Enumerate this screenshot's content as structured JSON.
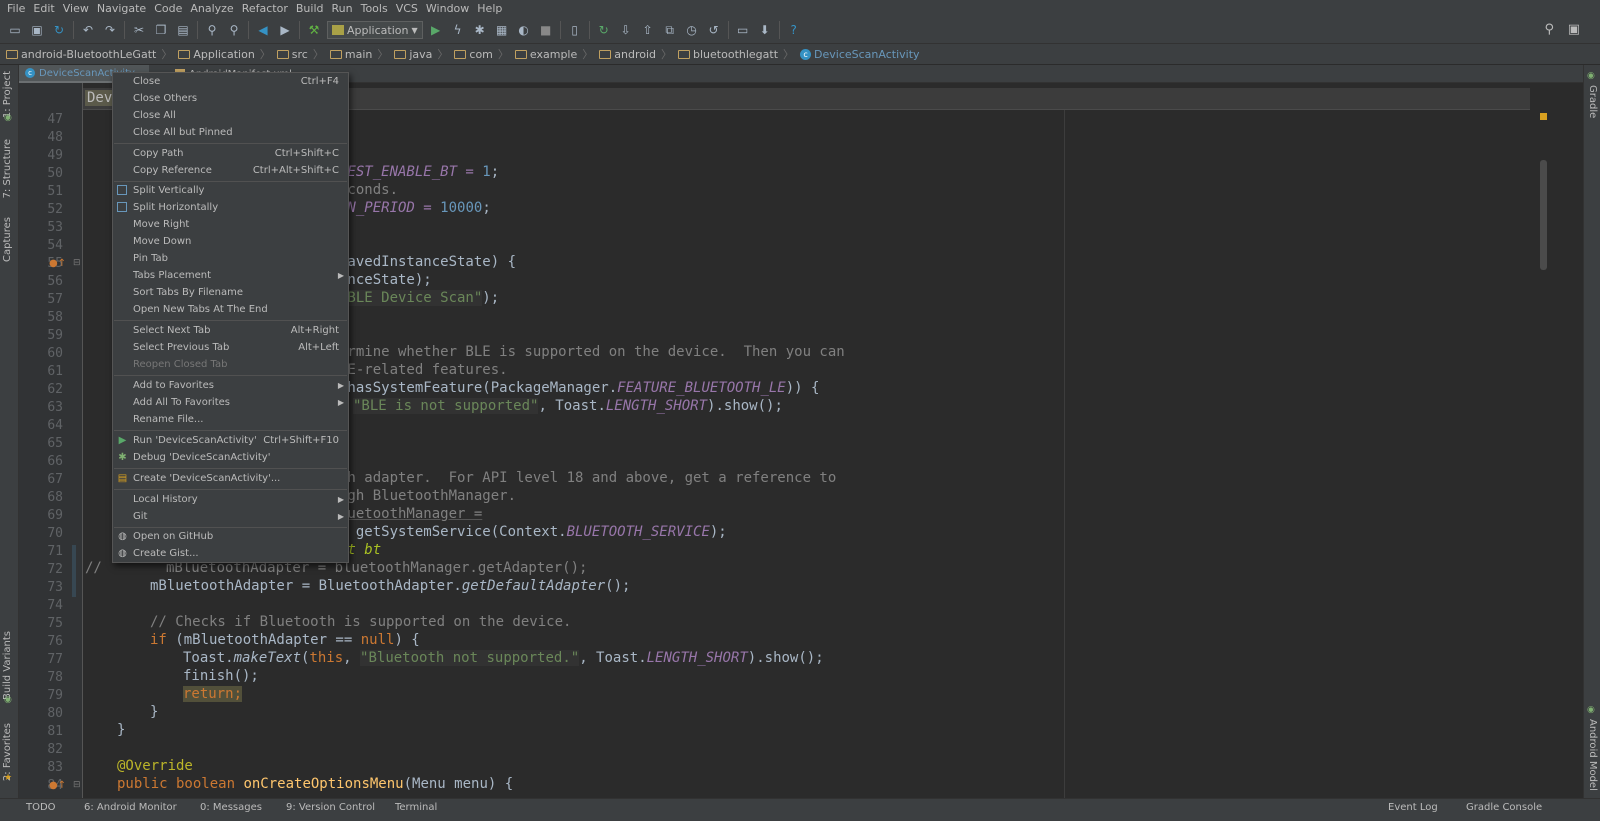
{
  "menubar": [
    "File",
    "Edit",
    "View",
    "Navigate",
    "Code",
    "Analyze",
    "Refactor",
    "Build",
    "Run",
    "Tools",
    "VCS",
    "Window",
    "Help"
  ],
  "toolbar": {
    "run_config": "Application"
  },
  "breadcrumbs": [
    "android-BluetoothLeGatt",
    "Application",
    "src",
    "main",
    "java",
    "com",
    "example",
    "android",
    "bluetoothlegatt",
    "DeviceScanActivity"
  ],
  "tabs": [
    "DeviceScanActivity",
    "AndroidManifest.xml"
  ],
  "scope_label": "Devi",
  "left_tools": [
    "1: Project",
    "7: Structure",
    "Captures",
    "Build Variants",
    "2: Favorites"
  ],
  "right_tools": [
    "Gradle",
    "Android Model"
  ],
  "bottom_tools": [
    "TODO",
    "6: Android Monitor",
    "0: Messages",
    "9: Version Control",
    "Terminal",
    "Event Log",
    "Gradle Console"
  ],
  "context_menu": [
    {
      "label": "Close",
      "shortcut": "Ctrl+F4"
    },
    {
      "label": "Close Others"
    },
    {
      "label": "Close All"
    },
    {
      "label": "Close All but Pinned"
    },
    {
      "sep": true
    },
    {
      "label": "Copy Path",
      "shortcut": "Ctrl+Shift+C"
    },
    {
      "label": "Copy Reference",
      "shortcut": "Ctrl+Alt+Shift+C"
    },
    {
      "sep": true
    },
    {
      "label": "Split Vertically",
      "icon": "split-vertical-icon"
    },
    {
      "label": "Split Horizontally",
      "icon": "split-horizontal-icon"
    },
    {
      "label": "Move Right"
    },
    {
      "label": "Move Down"
    },
    {
      "label": "Pin Tab"
    },
    {
      "label": "Tabs Placement",
      "submenu": true
    },
    {
      "label": "Sort Tabs By Filename"
    },
    {
      "label": "Open New Tabs At The End"
    },
    {
      "sep": true
    },
    {
      "label": "Select Next Tab",
      "shortcut": "Alt+Right"
    },
    {
      "label": "Select Previous Tab",
      "shortcut": "Alt+Left"
    },
    {
      "label": "Reopen Closed Tab",
      "disabled": true
    },
    {
      "sep": true
    },
    {
      "label": "Add to Favorites",
      "submenu": true
    },
    {
      "label": "Add All To Favorites",
      "submenu": true
    },
    {
      "label": "Rename File..."
    },
    {
      "sep": true
    },
    {
      "label": "Run 'DeviceScanActivity'",
      "shortcut": "Ctrl+Shift+F10",
      "icon": "run-icon"
    },
    {
      "label": "Debug 'DeviceScanActivity'",
      "icon": "debug-icon"
    },
    {
      "sep": true
    },
    {
      "label": "Create 'DeviceScanActivity'...",
      "icon": "create-config-icon"
    },
    {
      "sep": true
    },
    {
      "label": "Local History",
      "submenu": true
    },
    {
      "label": "Git",
      "submenu": true
    },
    {
      "sep": true
    },
    {
      "label": "Open on GitHub",
      "icon": "github-icon"
    },
    {
      "label": "Create Gist...",
      "icon": "github-icon"
    }
  ],
  "code": {
    "line_numbers": [
      "47",
      "48",
      "49",
      "50",
      "51",
      "52",
      "53",
      "54",
      "55",
      "56",
      "57",
      "58",
      "59",
      "60",
      "61",
      "62",
      "63",
      "64",
      "65",
      "66",
      "67",
      "68",
      "69",
      "70",
      "71",
      "72",
      "73",
      "74",
      "75",
      "76",
      "77",
      "78",
      "79",
      "80",
      "81",
      "82",
      "83",
      "84"
    ],
    "l50": "UEST_ENABLE_BT = ",
    "l50n": "1",
    "l51": "econds.",
    "l52": "AN_PERIOD = ",
    "l52n": "10000",
    "l55": "savedInstanceState) {",
    "l56": "anceState);",
    "l57": "\"BLE Device Scan\"",
    "l57e": ");",
    "l60": "ermine whether BLE is supported on the device.  Then you can",
    "l61": "LE-related features.",
    "l62a": ".hasSystemFeature(PackageManager.",
    "l62b": "FEATURE_BLUETOOTH_LE",
    "l62c": ")) {",
    "l63a": "\"BLE is not supported\"",
    "l63b": ", Toast.",
    "l63c": "LENGTH_SHORT",
    "l63d": ").show();",
    "l67": "th adapter.  For API level 18 and above, get a reference to",
    "l68": "ugh BluetoothManager.",
    "l69": "luetoothManager =",
    "l70a": ") getSystemService(Context.",
    "l70b": "BLUETOOTH_SERVICE",
    "l70c": ");",
    "l71": "lt bt",
    "l72pre": "//",
    "l72": "mBluetoothAdapter = bluetoothManager.getAdapter();",
    "l73a": "mBluetoothAdapter = BluetoothAdapter.",
    "l73b": "getDefaultAdapter",
    "l73c": "();",
    "l75": "// Checks if Bluetooth is supported on the device.",
    "l76a": "if",
    "l76b": " (mBluetoothAdapter == ",
    "l76c": "null",
    "l76d": ") {",
    "l77a": "Toast.",
    "l77b": "makeText",
    "l77c": "(",
    "l77d": "this",
    "l77e": ", ",
    "l77f": "\"Bluetooth not supported.\"",
    "l77g": ", Toast.",
    "l77h": "LENGTH_SHORT",
    "l77i": ").show();",
    "l78": "finish();",
    "l79": "return",
    "l79e": ";",
    "l80": "}",
    "l81": "}",
    "l83": "@Override",
    "l84a": "public boolean ",
    "l84b": "onCreateOptionsMenu",
    "l84c": "(Menu menu) {"
  }
}
